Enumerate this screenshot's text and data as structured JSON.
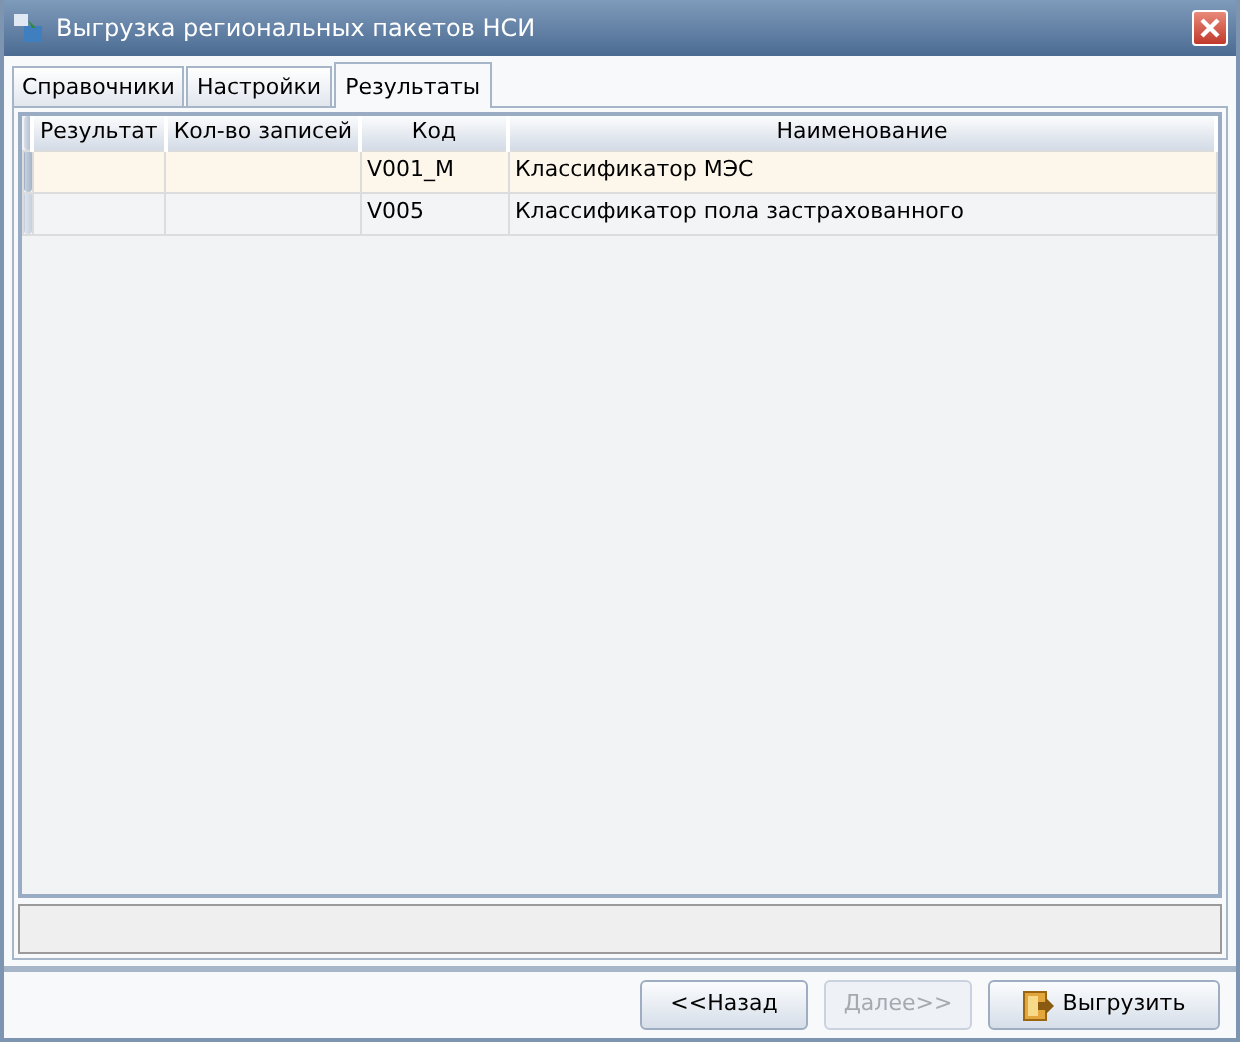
{
  "window": {
    "title": "Выгрузка региональных пакетов НСИ"
  },
  "tabs": [
    {
      "label": "Справочники",
      "selected": false
    },
    {
      "label": "Настройки",
      "selected": false
    },
    {
      "label": "Результаты",
      "selected": true
    }
  ],
  "table": {
    "columns": [
      "Результат",
      "Кол-во записей",
      "Код",
      "Наименование"
    ],
    "rows": [
      {
        "selected": true,
        "cells": [
          "",
          "",
          "V001_M",
          "Классификатор МЭС"
        ]
      },
      {
        "selected": false,
        "cells": [
          "",
          "",
          "V005",
          "Классификатор пола застрахованного"
        ]
      }
    ]
  },
  "buttons": [
    {
      "label": "<<Назад",
      "disabled": false,
      "kind": "plain"
    },
    {
      "label": "Далее>>",
      "disabled": true,
      "kind": "plain"
    },
    {
      "label": "Выгрузить",
      "disabled": false,
      "kind": "export"
    }
  ]
}
